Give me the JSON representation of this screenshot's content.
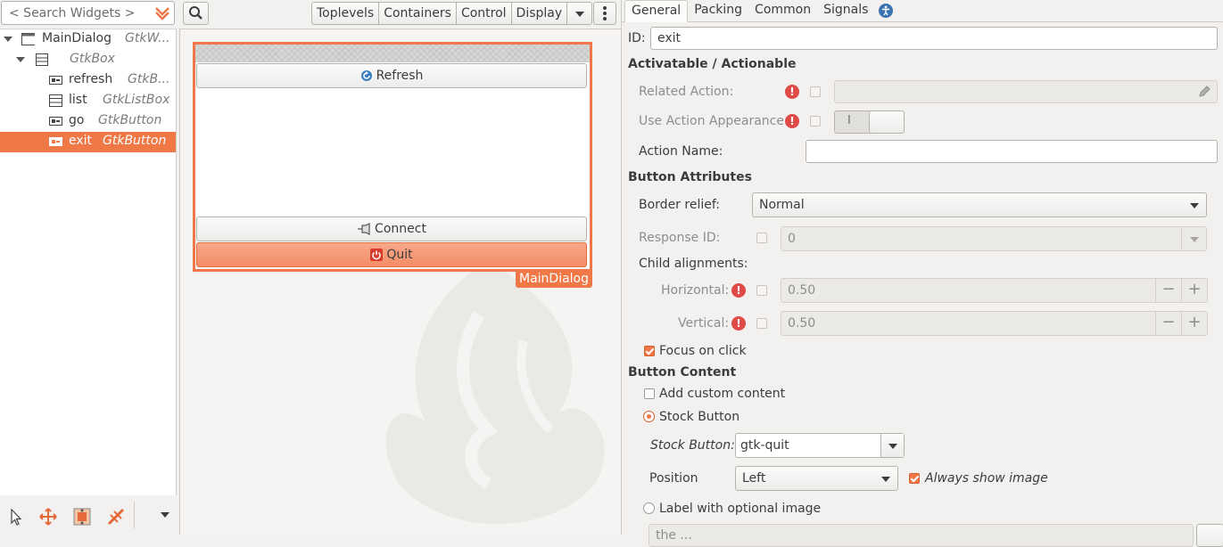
{
  "left": {
    "search_placeholder": "< Search Widgets >",
    "tree": [
      {
        "name": "MainDialog",
        "type": "GtkW...",
        "icon": "window-icon",
        "expanded": true
      },
      {
        "name": "",
        "type": "GtkBox",
        "icon": "box-icon",
        "expanded": true
      },
      {
        "name": "refresh",
        "type": "GtkB...",
        "icon": "button-icon"
      },
      {
        "name": "list",
        "type": "GtkListBox",
        "icon": "listbox-icon"
      },
      {
        "name": "go",
        "type": "GtkButton",
        "icon": "button-icon"
      },
      {
        "name": "exit",
        "type": "GtkButton",
        "icon": "button-icon",
        "selected": true
      }
    ],
    "tools": [
      "pointer-icon",
      "drag-resize-icon",
      "margin-edit-icon",
      "alignment-edit-icon"
    ]
  },
  "middle": {
    "group_tabs": [
      "Toplevels",
      "Containers",
      "Control",
      "Display"
    ],
    "dialog": {
      "refresh_label": "Refresh",
      "connect_label": "Connect",
      "quit_label": "Quit",
      "name_tag": "MainDialog"
    }
  },
  "right": {
    "tabs": [
      "General",
      "Packing",
      "Common",
      "Signals"
    ],
    "accessibility_tab_icon": "accessibility-icon",
    "id_label": "ID:",
    "id_value": "exit",
    "sec_activatable": "Activatable / Actionable",
    "related_action_label": "Related Action:",
    "use_action_appearance_label": "Use Action Appearance:",
    "toggle_on_text": "I",
    "action_name_label": "Action Name:",
    "sec_button_attrs": "Button Attributes",
    "border_relief_label": "Border relief:",
    "border_relief_value": "Normal",
    "response_id_label": "Response ID:",
    "response_id_value": "0",
    "child_alignments_label": "Child alignments:",
    "horizontal_label": "Horizontal:",
    "horizontal_value": "0.50",
    "vertical_label": "Vertical:",
    "vertical_value": "0.50",
    "focus_on_click_label": "Focus on click",
    "sec_button_content": "Button Content",
    "add_custom_content_label": "Add custom content",
    "stock_button_radio_label": "Stock Button",
    "stock_button_label": "Stock Button:",
    "stock_button_value": "gtk-quit",
    "position_label": "Position",
    "position_value": "Left",
    "always_show_image_label": "Always show image",
    "label_with_image_label": "Label with optional image",
    "label_entry_partial": "the ..."
  },
  "colors": {
    "accent": "#f07746",
    "warning": "#e04a46"
  }
}
